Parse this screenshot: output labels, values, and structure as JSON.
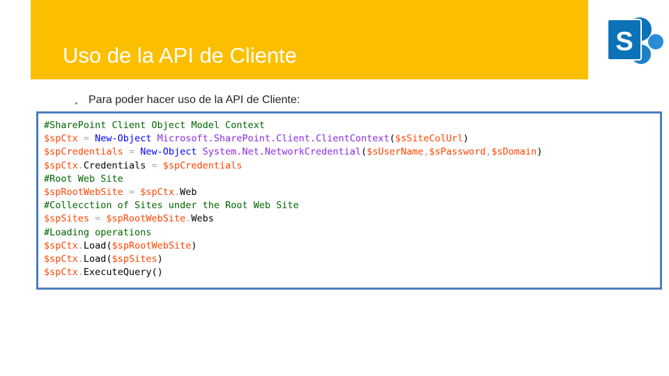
{
  "slide": {
    "title": "Uso de la API de Cliente",
    "bullet": "Para poder hacer uso de la API de Cliente:",
    "logo_letter": "S",
    "logo_icon": "sharepoint-logo-icon"
  },
  "colors": {
    "title_band": "#fcbf00",
    "code_border": "#4a7ebb",
    "comment": "#006400",
    "variable": "#ff4500",
    "cmdlet": "#0000ff",
    "type": "#8a2be2",
    "operator": "#a9a9a9",
    "logo_blue": "#0b72b7"
  },
  "code": [
    [
      {
        "t": "comment",
        "v": "#SharePoint Client Object Model Context"
      }
    ],
    [
      {
        "t": "var",
        "v": "$spCtx"
      },
      {
        "t": "op",
        "v": " = "
      },
      {
        "t": "cmdlet",
        "v": "New-Object"
      },
      {
        "t": "type",
        "v": " Microsoft.SharePoint.Client.ClientContext"
      },
      {
        "t": "punct",
        "v": "("
      },
      {
        "t": "var",
        "v": "$sSiteColUrl"
      },
      {
        "t": "punct",
        "v": ")"
      }
    ],
    [
      {
        "t": "var",
        "v": "$spCredentials"
      },
      {
        "t": "op",
        "v": " = "
      },
      {
        "t": "cmdlet",
        "v": "New-Object"
      },
      {
        "t": "type",
        "v": " System.Net.NetworkCredential"
      },
      {
        "t": "punct",
        "v": "("
      },
      {
        "t": "var",
        "v": "$sUserName"
      },
      {
        "t": "op",
        "v": ","
      },
      {
        "t": "var",
        "v": "$sPassword"
      },
      {
        "t": "op",
        "v": ","
      },
      {
        "t": "var",
        "v": "$sDomain"
      },
      {
        "t": "punct",
        "v": ")"
      }
    ],
    [
      {
        "t": "var",
        "v": "$spCtx"
      },
      {
        "t": "op",
        "v": "."
      },
      {
        "t": "member",
        "v": "Credentials"
      },
      {
        "t": "op",
        "v": " = "
      },
      {
        "t": "var",
        "v": "$spCredentials"
      }
    ],
    [
      {
        "t": "comment",
        "v": "#Root Web Site"
      }
    ],
    [
      {
        "t": "var",
        "v": "$spRootWebSite"
      },
      {
        "t": "op",
        "v": " = "
      },
      {
        "t": "var",
        "v": "$spCtx"
      },
      {
        "t": "op",
        "v": "."
      },
      {
        "t": "member",
        "v": "Web"
      }
    ],
    [
      {
        "t": "comment",
        "v": "#Collecction of Sites under the Root Web Site"
      }
    ],
    [
      {
        "t": "var",
        "v": "$spSites"
      },
      {
        "t": "op",
        "v": " = "
      },
      {
        "t": "var",
        "v": "$spRootWebSite"
      },
      {
        "t": "op",
        "v": "."
      },
      {
        "t": "member",
        "v": "Webs"
      }
    ],
    [
      {
        "t": "comment",
        "v": "#Loading operations"
      }
    ],
    [
      {
        "t": "var",
        "v": "$spCtx"
      },
      {
        "t": "op",
        "v": "."
      },
      {
        "t": "member",
        "v": "Load"
      },
      {
        "t": "punct",
        "v": "("
      },
      {
        "t": "var",
        "v": "$spRootWebSite"
      },
      {
        "t": "punct",
        "v": ")"
      }
    ],
    [
      {
        "t": "var",
        "v": "$spCtx"
      },
      {
        "t": "op",
        "v": "."
      },
      {
        "t": "member",
        "v": "Load"
      },
      {
        "t": "punct",
        "v": "("
      },
      {
        "t": "var",
        "v": "$spSites"
      },
      {
        "t": "punct",
        "v": ")"
      }
    ],
    [
      {
        "t": "var",
        "v": "$spCtx"
      },
      {
        "t": "op",
        "v": "."
      },
      {
        "t": "member",
        "v": "ExecuteQuery"
      },
      {
        "t": "punct",
        "v": "()"
      }
    ]
  ]
}
